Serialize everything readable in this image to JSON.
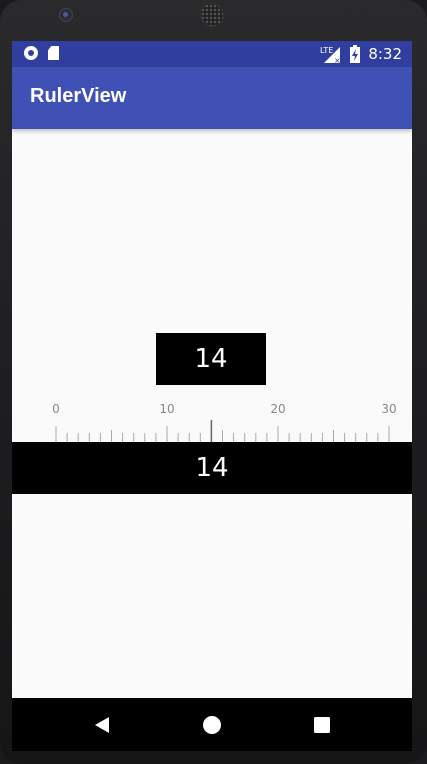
{
  "status_bar": {
    "time": "8:32",
    "network": "LTE",
    "icons": [
      "notification-circle-icon",
      "sd-card-icon",
      "signal-icon",
      "battery-charging-icon"
    ]
  },
  "app_bar": {
    "title": "RulerView"
  },
  "value_display": {
    "value": "14"
  },
  "ruler": {
    "labels": [
      "0",
      "10",
      "20",
      "30"
    ],
    "min": 0,
    "max": 30,
    "current": 14,
    "tick_color": "#aaaaaa",
    "indicator_color": "#666666"
  },
  "value_bar": {
    "value": "14"
  },
  "nav_bar": {
    "icons": [
      "back-icon",
      "home-icon",
      "recents-icon"
    ]
  },
  "colors": {
    "status_bar": "#303f9f",
    "app_bar": "#3f51b5",
    "background": "#fafafa"
  }
}
